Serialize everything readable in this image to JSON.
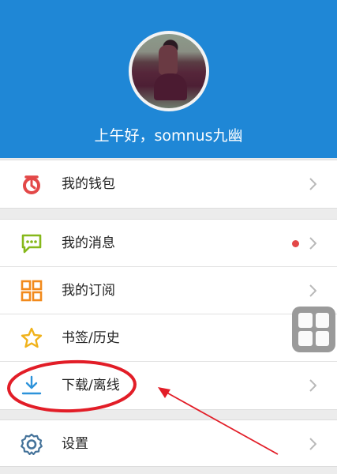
{
  "profile": {
    "greeting": "上午好，somnus九幽"
  },
  "menu": {
    "wallet": "我的钱包",
    "messages": "我的消息",
    "subscriptions": "我的订阅",
    "bookmarks": "书签/历史",
    "downloads": "下载/离线",
    "settings": "设置"
  },
  "colors": {
    "header_blue": "#1f87d6",
    "wallet_red": "#e34848",
    "messages_green": "#86b81b",
    "subscriptions_orange": "#f28a1c",
    "bookmarks_yellow": "#f0b21b",
    "downloads_blue": "#2d93da",
    "settings_blue": "#45739a",
    "annotation_red": "#e21d27"
  },
  "icons": {
    "wallet": "wallet-icon",
    "messages": "message-icon",
    "subscriptions": "grid-icon",
    "bookmarks": "star-icon",
    "downloads": "download-icon",
    "settings": "gear-icon"
  }
}
